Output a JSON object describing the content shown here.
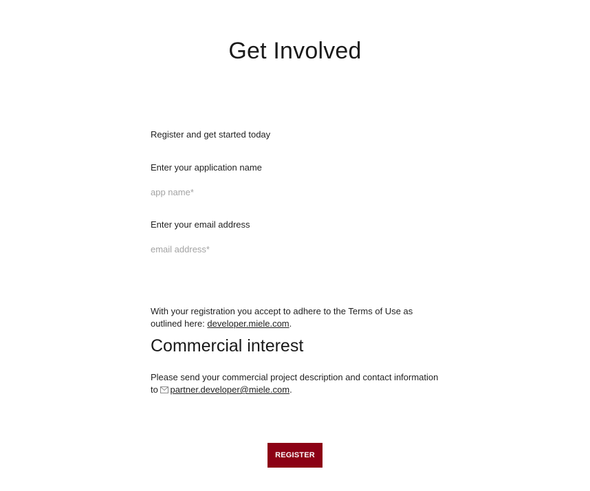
{
  "page": {
    "title": "Get Involved"
  },
  "form": {
    "lead": "Register and get started today",
    "app_name": {
      "label": "Enter your application name",
      "placeholder": "app name*",
      "value": ""
    },
    "email": {
      "label": "Enter your email address",
      "placeholder": "email address*",
      "value": ""
    }
  },
  "terms": {
    "text_before": "With your registration you accept to adhere to the Terms of Use as outlined here: ",
    "link_text": "developer.miele.com",
    "text_after": "."
  },
  "commercial": {
    "heading": "Commercial interest",
    "text_before": "Please send your commercial project description and contact information to ",
    "email_icon": "envelope-icon",
    "email_link": "partner.developer@miele.com",
    "text_after": "."
  },
  "actions": {
    "register_label": "REGISTER"
  },
  "colors": {
    "accent": "#8c0014",
    "text": "#1f1f1f",
    "placeholder": "#a3a3a3",
    "background": "#ffffff"
  }
}
